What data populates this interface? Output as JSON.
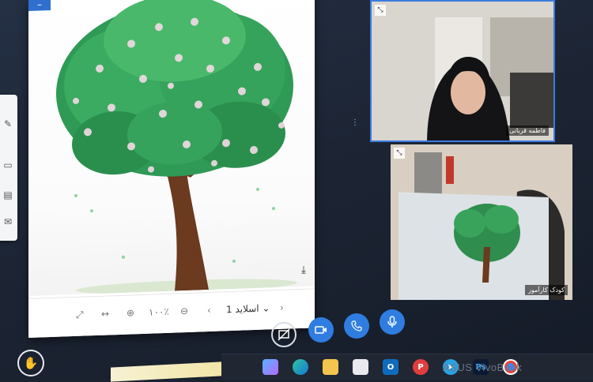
{
  "slide_viewer": {
    "zoom_label": "۱۰۰٪",
    "slide_label": "اسلاید 1",
    "minus_label": "–"
  },
  "video_tiles": [
    {
      "name": "فاطمه قربانی"
    },
    {
      "name": "کودک کارآموز"
    }
  ],
  "colors": {
    "accent": "#2f7de1",
    "background": "#1d2535",
    "tile_border": "#3b7be0"
  },
  "taskbar": {
    "brand": "ASUS VivoBook",
    "icons": [
      "copilot-icon",
      "edge-icon",
      "file-explorer-icon",
      "store-icon",
      "outlook-icon",
      "pinterest-icon",
      "telegram-icon",
      "photoshop-icon",
      "chrome-icon"
    ]
  },
  "controls": [
    "hand-raise-icon",
    "screen-share-off-icon",
    "camera-icon",
    "phone-icon",
    "microphone-icon"
  ]
}
